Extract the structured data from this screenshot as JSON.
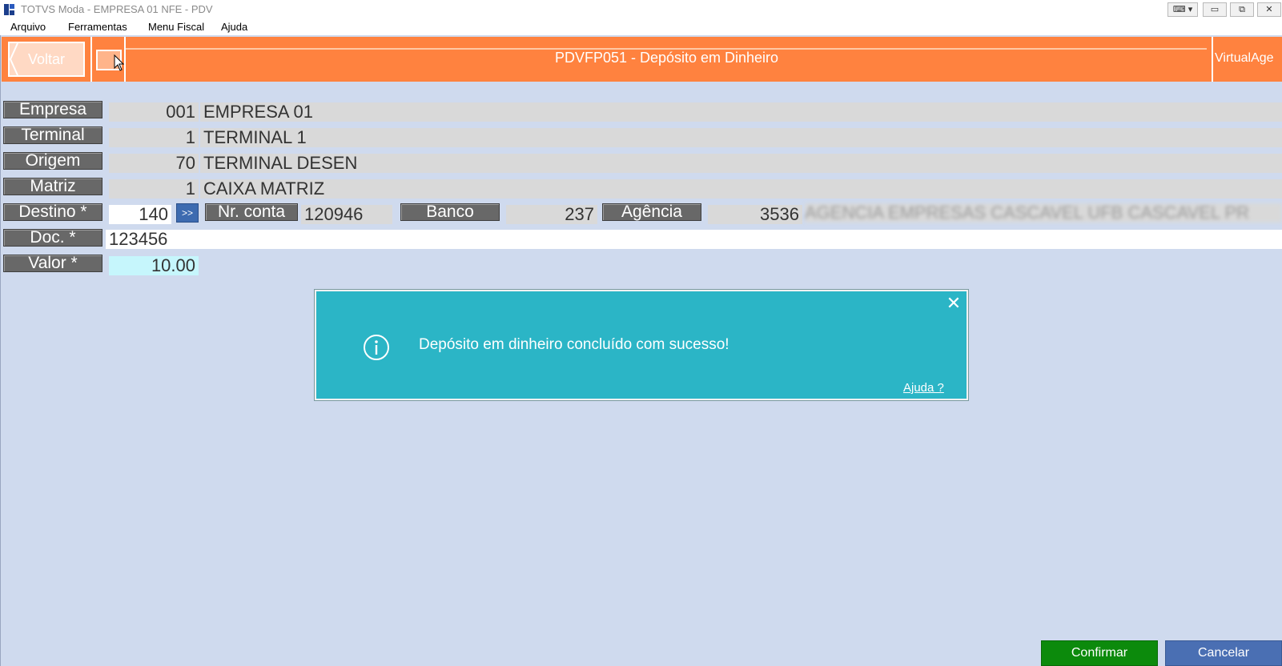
{
  "window": {
    "title": "TOTVS Moda - EMPRESA 01 NFE - PDV",
    "minimize": "▭",
    "restore": "⧉",
    "close": "✕"
  },
  "menu": [
    "Arquivo",
    "Ferramentas",
    "Menu Fiscal",
    "Ajuda"
  ],
  "header": {
    "back_label": "Voltar",
    "title": "PDVFP051 - Depósito em Dinheiro",
    "right_label": "VirtualAge"
  },
  "form": {
    "empresa": {
      "label": "Empresa",
      "code": "001",
      "name": "EMPRESA 01"
    },
    "terminal": {
      "label": "Terminal",
      "code": "1",
      "name": "TERMINAL 1"
    },
    "origem": {
      "label": "Origem",
      "code": "70",
      "name": "TERMINAL DESEN"
    },
    "matriz": {
      "label": "Matriz",
      "code": "1",
      "name": "CAIXA MATRIZ"
    },
    "destino": {
      "label": "Destino *",
      "code": "140",
      "more": ">>"
    },
    "nr_conta": {
      "label": "Nr. conta",
      "value": "120946"
    },
    "banco": {
      "label": "Banco",
      "value": "237"
    },
    "agencia": {
      "label": "Agência",
      "value": "3536",
      "name_blurred": "AGENCIA EMPRESAS CASCAVEL UFB CASCAVEL PR"
    },
    "doc": {
      "label": "Doc. *",
      "value": "123456"
    },
    "valor": {
      "label": "Valor *",
      "value": "10.00"
    }
  },
  "dialog": {
    "message": "Depósito em dinheiro concluído com sucesso!",
    "help_link": "Ajuda ?",
    "close": "✕"
  },
  "buttons": {
    "confirm": "Confirmar",
    "cancel": "Cancelar"
  }
}
